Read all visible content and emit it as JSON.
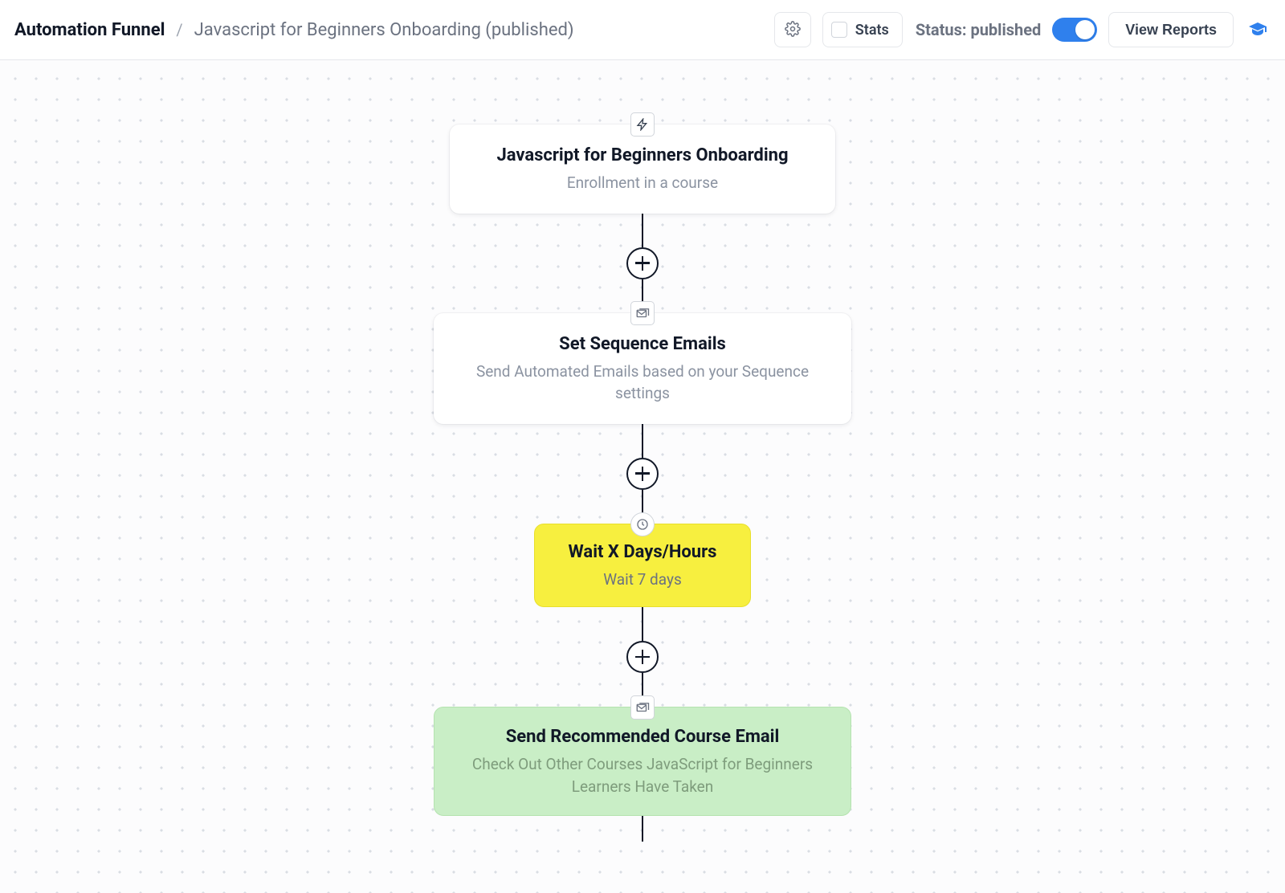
{
  "header": {
    "breadcrumb_root": "Automation Funnel",
    "breadcrumb_sep": "/",
    "breadcrumb_leaf": "Javascript for Beginners Onboarding (published)",
    "stats_label": "Stats",
    "status_label": "Status: published",
    "view_reports_label": "View Reports",
    "toggle_on": true
  },
  "flow": {
    "nodes": [
      {
        "kind": "trigger",
        "icon": "lightning-icon",
        "title": "Javascript for Beginners Onboarding",
        "subtitle": "Enrollment in a course"
      },
      {
        "kind": "email",
        "icon": "mail-stack-icon",
        "title": "Set Sequence Emails",
        "subtitle": "Send Automated Emails based on your Sequence settings"
      },
      {
        "kind": "wait",
        "icon": "clock-icon",
        "title": "Wait X Days/Hours",
        "subtitle": "Wait 7 days"
      },
      {
        "kind": "send",
        "icon": "mail-stack-icon",
        "title": "Send Recommended Course Email",
        "subtitle": "Check Out Other Courses JavaScript for Beginners Learners Have Taken"
      }
    ]
  }
}
